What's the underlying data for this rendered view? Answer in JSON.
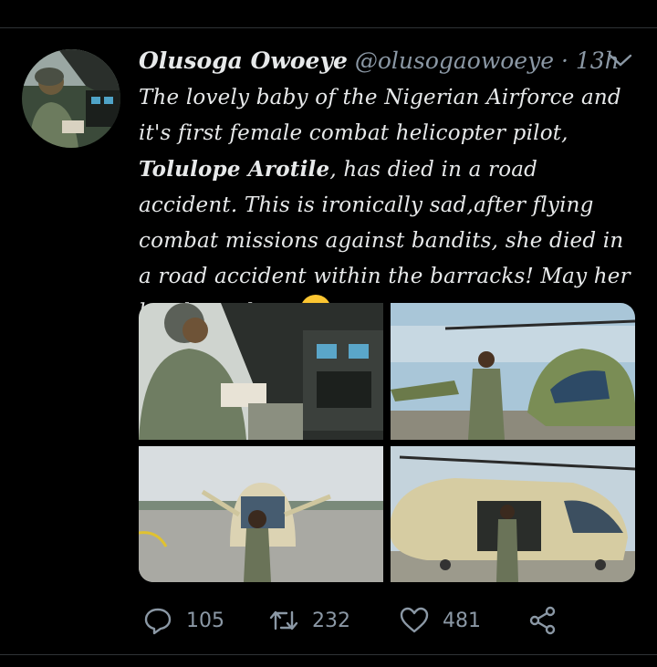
{
  "tweet": {
    "author_name": "Olusoga Owoeye",
    "handle": "@olusogaowoeye",
    "separator": "·",
    "time": "13h",
    "text_part1": "The lovely baby of the Nigerian Airforce and it's first female combat helicopter pilot, ",
    "text_bold": "Tolulope Arotile",
    "text_part2": ", has died in a road accident. This is ironically sad,after flying combat missions against bandits, she died in a road accident within the barracks! May her lovely soul RIP",
    "emoji": "flushed-face-emoji"
  },
  "stats": {
    "replies": "105",
    "retweets": "232",
    "likes": "481"
  },
  "icons": {
    "reply": "reply-icon",
    "retweet": "retweet-icon",
    "like": "heart-icon",
    "share": "share-icon",
    "more": "chevron-down-icon"
  },
  "colors": {
    "background": "#000000",
    "text": "#e7e9ea",
    "secondary": "#8b98a5"
  }
}
